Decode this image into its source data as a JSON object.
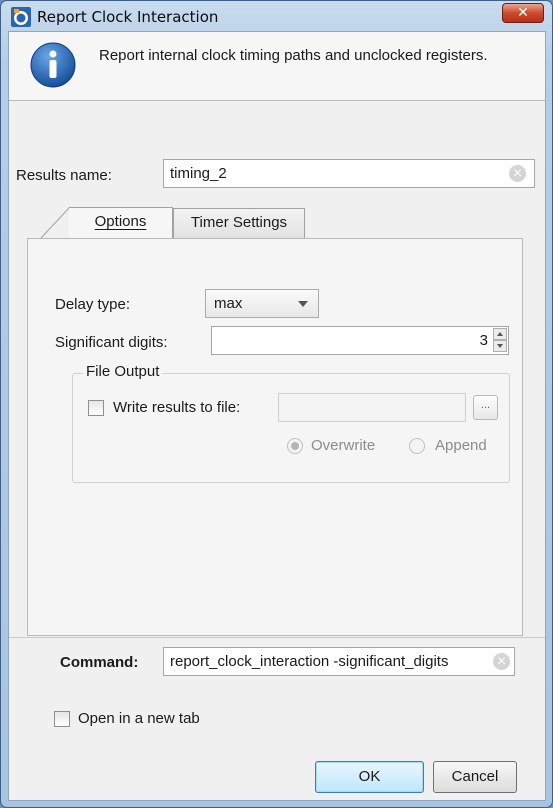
{
  "window": {
    "title": "Report Clock Interaction",
    "close_glyph": "✕"
  },
  "header": {
    "icon": "info-icon",
    "description": "Report internal clock timing paths and unclocked registers."
  },
  "results_name": {
    "label": "Results name:",
    "value": "timing_2"
  },
  "tabs": [
    {
      "label": "Options",
      "active": true
    },
    {
      "label": "Timer Settings",
      "active": false
    }
  ],
  "options": {
    "delay_type_label": "Delay type:",
    "delay_type_value": "max",
    "significant_digits_label": "Significant digits:",
    "significant_digits_value": "3",
    "file_output": {
      "title": "File Output",
      "write_label": "Write results to file:",
      "write_checked": false,
      "file_path": "",
      "browse_label": "...",
      "overwrite_label": "Overwrite",
      "append_label": "Append",
      "selected_mode": "Overwrite"
    }
  },
  "command": {
    "label": "Command:",
    "value": "report_clock_interaction -significant_digits"
  },
  "open_new_tab": {
    "label": "Open in a new tab",
    "checked": false
  },
  "buttons": {
    "ok": "OK",
    "cancel": "Cancel"
  },
  "colors": {
    "title_bar": "#b6cde6",
    "close_button": "#cc4a2c",
    "default_button": "#bee6fd"
  }
}
